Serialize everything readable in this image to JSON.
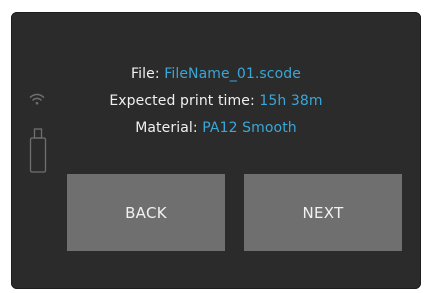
{
  "info": {
    "file_label": "File:",
    "file_value": "FileName_01.scode",
    "time_label": "Expected print time:",
    "time_value": "15h 38m",
    "material_label": "Material:",
    "material_value": "PA12 Smooth"
  },
  "buttons": {
    "back_label": "BACK",
    "next_label": "NEXT"
  },
  "icons": {
    "status_left_top": "wifi-icon",
    "status_left_bottom": "usb-icon"
  },
  "colors": {
    "background": "#2b2b2b",
    "text": "#f0f0f0",
    "accent": "#39a7d8",
    "button": "#6f6f6f"
  }
}
